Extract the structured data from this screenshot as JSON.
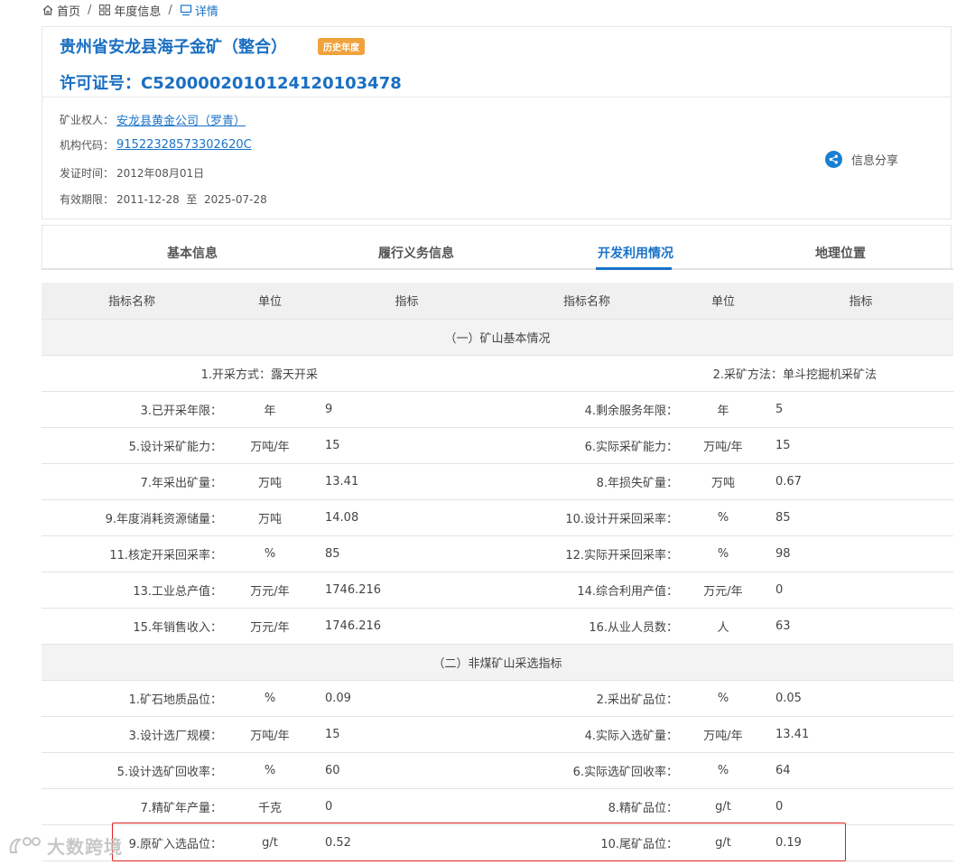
{
  "breadcrumb": {
    "home": "首页",
    "year_info": "年度信息",
    "detail": "详情"
  },
  "header": {
    "title": "贵州省安龙县海子金矿（整合）",
    "badge": "历史年度",
    "license": "许可证号：C5200002010124120103478",
    "owner_label": "矿业权人：",
    "owner_value": "安龙县黄金公司（罗青）",
    "org_label": "机构代码：",
    "org_value": "91522328573302620C",
    "issue_label": "发证时间：",
    "issue_value": "2012年08月01日",
    "valid_label": "有效期限：",
    "valid_value": "2011-12-28  至  2025-07-28",
    "share_label": "信息分享"
  },
  "tabs": [
    {
      "label": "基本信息"
    },
    {
      "label": "履行义务信息"
    },
    {
      "label": "开发利用情况"
    },
    {
      "label": "地理位置"
    }
  ],
  "table": {
    "headers": [
      "指标名称",
      "单位",
      "指标",
      "指标名称",
      "单位",
      "指标"
    ],
    "section1": "（一）矿山基本情况",
    "section2": "（二）非煤矿山采选指标",
    "row1": {
      "left": "1.开采方式：露天开采",
      "right": "2.采矿方法：单斗挖掘机采矿法"
    },
    "rows_a": [
      [
        "3.已开采年限：",
        "年",
        "9",
        "4.剩余服务年限：",
        "年",
        "5"
      ],
      [
        "5.设计采矿能力：",
        "万吨/年",
        "15",
        "6.实际采矿能力：",
        "万吨/年",
        "15"
      ],
      [
        "7.年采出矿量：",
        "万吨",
        "13.41",
        "8.年损失矿量：",
        "万吨",
        "0.67"
      ],
      [
        "9.年度消耗资源储量：",
        "万吨",
        "14.08",
        "10.设计开采回采率：",
        "%",
        "85"
      ],
      [
        "11.核定开采回采率：",
        "%",
        "85",
        "12.实际开采回采率：",
        "%",
        "98"
      ],
      [
        "13.工业总产值：",
        "万元/年",
        "1746.216",
        "14.综合利用产值：",
        "万元/年",
        "0"
      ],
      [
        "15.年销售收入：",
        "万元/年",
        "1746.216",
        "16.从业人员数：",
        "人",
        "63"
      ]
    ],
    "rows_b": [
      [
        "1.矿石地质品位：",
        "%",
        "0.09",
        "2.采出矿品位：",
        "%",
        "0.05"
      ],
      [
        "3.设计选厂规模：",
        "万吨/年",
        "15",
        "4.实际入选矿量：",
        "万吨/年",
        "13.41"
      ],
      [
        "5.设计选矿回收率：",
        "%",
        "60",
        "6.实际选矿回收率：",
        "%",
        "64"
      ],
      [
        "7.精矿年产量：",
        "千克",
        "0",
        "8.精矿品位：",
        "g/t",
        "0"
      ],
      [
        "9.原矿入选品位：",
        "g/t",
        "0.52",
        "10.尾矿品位：",
        "g/t",
        "0.19"
      ]
    ]
  },
  "watermark": "大数跨境",
  "colors": {
    "accent": "#1a73c8",
    "badge": "#f0a33d",
    "highlight": "#e0201e"
  }
}
